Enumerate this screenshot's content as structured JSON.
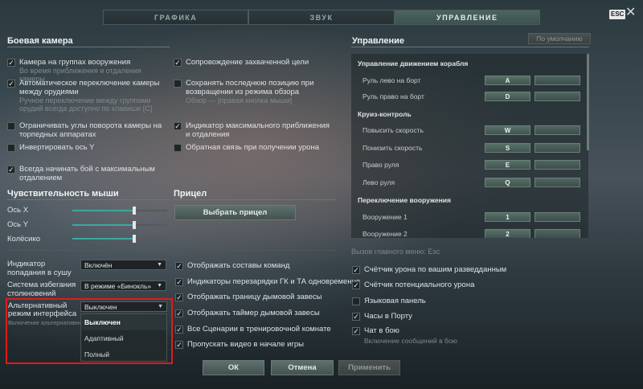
{
  "tabs": [
    {
      "label": "ГРАФИКА",
      "active": false
    },
    {
      "label": "ЗВУК",
      "active": false
    },
    {
      "label": "УПРАВЛЕНИЕ",
      "active": true
    }
  ],
  "esc_badge": "ESC",
  "close_glyph": "✕",
  "camera": {
    "title": "Боевая камера",
    "left": [
      {
        "label": "Камера на группах вооружения",
        "sub": "Во время приближения и отдаления камеры",
        "checked": true
      },
      {
        "label": "Автоматическое переключение камеры между орудиями",
        "sub": "Ручное переключение между группами орудий всегда доступно по клавише [C]",
        "checked": true
      },
      {
        "label": "Ограничивать углы поворота камеры на торпедных аппаратах",
        "checked": false
      },
      {
        "label": "Инвертировать ось Y",
        "checked": false
      },
      {
        "label": "Всегда начинать бой с максимальным отдалением",
        "checked": true
      }
    ],
    "right": [
      {
        "label": "Сопровождение захваченной цели",
        "checked": true
      },
      {
        "label": "Сохранять последнюю позицию при возвращении из режима обзора",
        "sub": "Обзор — [правая кнопка мыши]",
        "checked": false
      },
      {
        "label": "Индикатор максимального приближения и отдаления",
        "checked": true
      },
      {
        "label": "Обратная связь при получении урона",
        "checked": false
      }
    ]
  },
  "mouse": {
    "title": "Чувствительность мыши",
    "sliders": [
      {
        "label": "Ось X",
        "value": 0.65
      },
      {
        "label": "Ось Y",
        "value": 0.65
      },
      {
        "label": "Колёсико",
        "value": 0.65
      }
    ]
  },
  "sight": {
    "title": "Прицел",
    "button": "Выбрать прицел"
  },
  "controls": {
    "title": "Управление",
    "default_button": "По умолчанию",
    "groups": [
      {
        "title": "Управление движением корабля",
        "rows": [
          {
            "label": "Руль лево на борт",
            "key": "A"
          },
          {
            "label": "Руль право на борт",
            "key": "D"
          }
        ]
      },
      {
        "title": "Круиз-контроль",
        "rows": [
          {
            "label": "Повысить скорость",
            "key": "W"
          },
          {
            "label": "Понизить скорость",
            "key": "S"
          },
          {
            "label": "Право руля",
            "key": "E"
          },
          {
            "label": "Лево руля",
            "key": "Q"
          }
        ]
      },
      {
        "title": "Переключение вооружения",
        "rows": [
          {
            "label": "Вооружение 1",
            "key": "1"
          },
          {
            "label": "Вооружение 2",
            "key": "2"
          }
        ]
      }
    ]
  },
  "main_menu_hint": "Вызов главного меню: Esc",
  "interface_right": [
    {
      "label": "Счётчик урона по вашим разведданным",
      "checked": true
    },
    {
      "label": "Счётчик потенциального урона",
      "checked": true
    },
    {
      "label": "Языковая панель",
      "checked": false
    },
    {
      "label": "Часы в Порту",
      "checked": true
    },
    {
      "label": "Чат в бою",
      "sub": "Включение сообщений в бою",
      "checked": true
    }
  ],
  "dropdowns": {
    "hit_indicator": {
      "label": "Индикатор попадания в сушу",
      "value": "Включён"
    },
    "collision": {
      "label": "Система избегания столкновений",
      "value": "В режиме «Бинокль»"
    },
    "alt_mode": {
      "label": "Альтернативный режим интерфейса",
      "value": "Выключен",
      "sub": "Включение альтернативного режима может повлиять на производительность",
      "options": [
        "Выключен",
        "Адаптивный",
        "Полный"
      ]
    }
  },
  "team_checks": [
    {
      "label": "Отображать составы команд",
      "checked": true
    },
    {
      "label": "Индикаторы перезарядки ГК и ТА одновременно",
      "checked": true
    },
    {
      "label": "Отображать границу дымовой завесы",
      "checked": true
    },
    {
      "label": "Отображать таймер дымовой завесы",
      "checked": true
    },
    {
      "label": "Все Сценарии в тренировочной комнате",
      "checked": true
    },
    {
      "label": "Пропускать видео в начале игры",
      "checked": true
    }
  ],
  "footer": {
    "ok": "ОК",
    "cancel": "Отмена",
    "apply": "Применить"
  }
}
